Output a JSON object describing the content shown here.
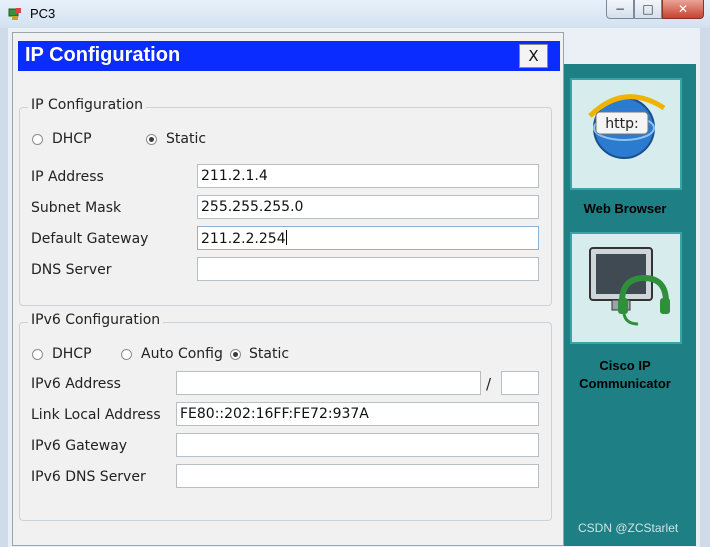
{
  "window": {
    "title": "PC3",
    "controls": {
      "minimize": "−",
      "maximize": "□",
      "close": "✕"
    }
  },
  "dialog": {
    "title": "IP Configuration",
    "close_label": "X"
  },
  "ipv4": {
    "group_title": "IP Configuration",
    "dhcp_label": "DHCP",
    "static_label": "Static",
    "selected_mode": "Static",
    "fields": {
      "ip_address_label": "IP Address",
      "ip_address_value": "211.2.1.4",
      "subnet_mask_label": "Subnet Mask",
      "subnet_mask_value": "255.255.255.0",
      "default_gateway_label": "Default Gateway",
      "default_gateway_value": "211.2.2.254",
      "dns_server_label": "DNS Server",
      "dns_server_value": ""
    }
  },
  "ipv6": {
    "group_title": "IPv6 Configuration",
    "dhcp_label": "DHCP",
    "auto_config_label": "Auto Config",
    "static_label": "Static",
    "selected_mode": "Static",
    "fields": {
      "ipv6_address_label": "IPv6 Address",
      "ipv6_address_value": "",
      "prefix_separator": "/",
      "prefix_value": "",
      "link_local_label": "Link Local Address",
      "link_local_value": "FE80::202:16FF:FE72:937A",
      "ipv6_gateway_label": "IPv6 Gateway",
      "ipv6_gateway_value": "",
      "ipv6_dns_label": "IPv6 DNS Server",
      "ipv6_dns_value": ""
    }
  },
  "desktop_apps": [
    {
      "label": "Web Browser",
      "icon": "web-browser-icon",
      "icon_text": "http:"
    },
    {
      "label": "Cisco IP Communicator",
      "icon": "ip-communicator-icon"
    }
  ],
  "watermark": "CSDN @ZCStarlet",
  "colors": {
    "dialog_title_bg": "#0a2cff",
    "desktop_panel": "#1e7f85"
  }
}
